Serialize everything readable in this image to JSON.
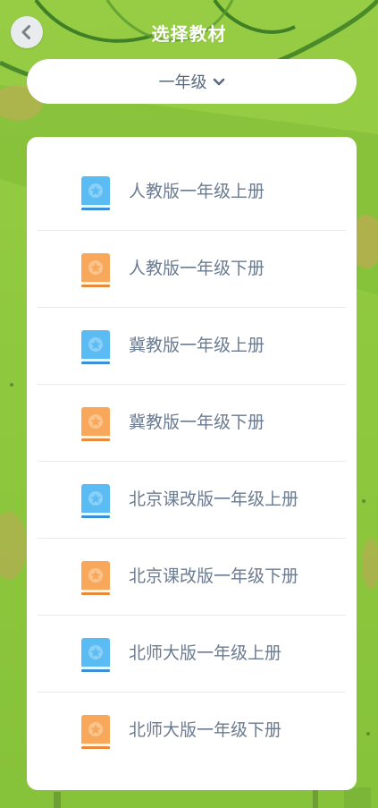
{
  "header": {
    "title": "选择教材",
    "back_icon": "chevron-left-icon"
  },
  "grade_select": {
    "value": "一年级",
    "icon": "chevron-down-icon"
  },
  "colors": {
    "background": "#8cc63f",
    "book_blue": "#5bbcf3",
    "book_orange": "#f7a85a",
    "text": "#6b7b90"
  },
  "textbooks": [
    {
      "label": "人教版一年级上册",
      "icon": "book-blue-icon"
    },
    {
      "label": "人教版一年级下册",
      "icon": "book-orange-icon"
    },
    {
      "label": "冀教版一年级上册",
      "icon": "book-blue-icon"
    },
    {
      "label": "冀教版一年级下册",
      "icon": "book-orange-icon"
    },
    {
      "label": "北京课改版一年级上册",
      "icon": "book-blue-icon"
    },
    {
      "label": "北京课改版一年级下册",
      "icon": "book-orange-icon"
    },
    {
      "label": "北师大版一年级上册",
      "icon": "book-blue-icon"
    },
    {
      "label": "北师大版一年级下册",
      "icon": "book-orange-icon"
    }
  ]
}
